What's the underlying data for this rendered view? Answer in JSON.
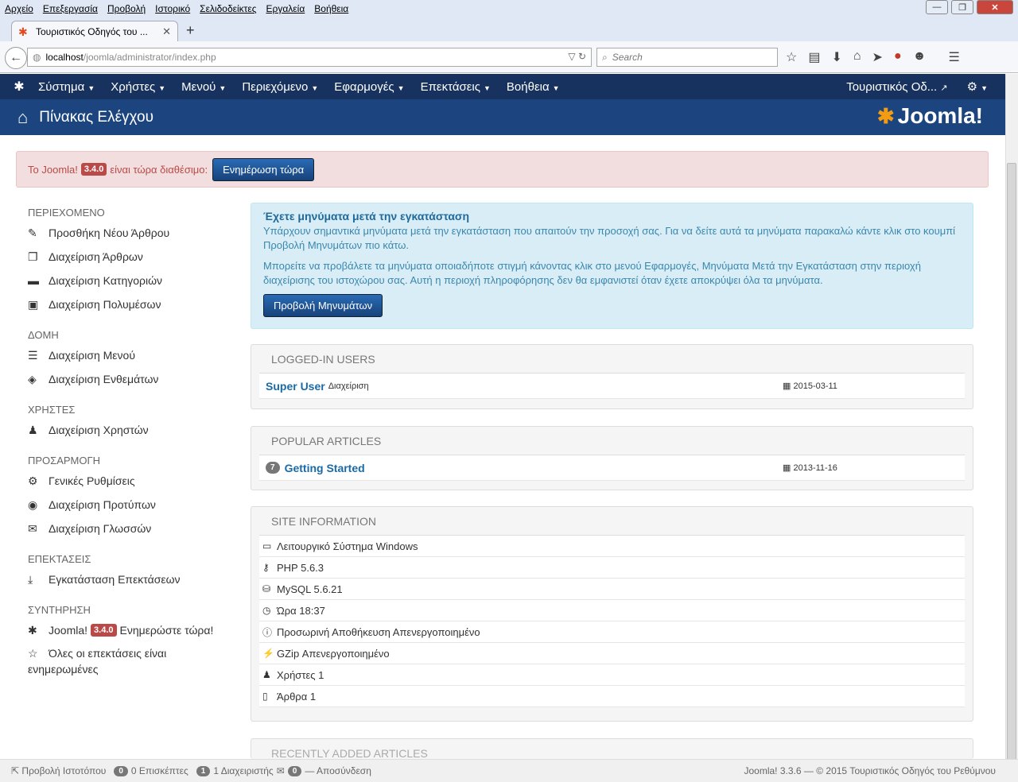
{
  "browser": {
    "menu": [
      "Αρχείο",
      "Επεξεργασία",
      "Προβολή",
      "Ιστορικό",
      "Σελιδοδείκτες",
      "Εργαλεία",
      "Βοήθεια"
    ],
    "window_controls": [
      "—",
      "❐",
      "✕"
    ],
    "tab_title": "Τουριστικός Οδηγός του ...",
    "url_host": "localhost",
    "url_path": "/joomla/administrator/index.php",
    "search_placeholder": "Search"
  },
  "joomla_nav": {
    "items": [
      "Σύστημα",
      "Χρήστες",
      "Μενού",
      "Περιεχόμενο",
      "Εφαρμογές",
      "Επεκτάσεις",
      "Βοήθεια"
    ],
    "site_link": "Τουριστικός Οδ...",
    "gear": "⚙"
  },
  "header": {
    "title": "Πίνακας Ελέγχου",
    "logo_text": "Joomla!"
  },
  "update_alert": {
    "prefix": "Το Joomla!",
    "version": "3.4.0",
    "suffix": "είναι τώρα διαθέσιμο:",
    "button": "Ενημέρωση τώρα"
  },
  "sidebar": {
    "groups": [
      {
        "title": "ΠΕΡΙΕΧΟΜΕΝΟ",
        "items": [
          {
            "icon": "✎",
            "label": "Προσθήκη Νέου Άρθρου"
          },
          {
            "icon": "❐",
            "label": "Διαχείριση Άρθρων"
          },
          {
            "icon": "▬",
            "label": "Διαχείριση Κατηγοριών"
          },
          {
            "icon": "▣",
            "label": "Διαχείριση Πολυμέσων"
          }
        ]
      },
      {
        "title": "ΔΟΜΗ",
        "items": [
          {
            "icon": "☰",
            "label": "Διαχείριση Μενού"
          },
          {
            "icon": "◈",
            "label": "Διαχείριση Ενθεμάτων"
          }
        ]
      },
      {
        "title": "ΧΡΗΣΤΕΣ",
        "items": [
          {
            "icon": "♟",
            "label": "Διαχείριση Χρηστών"
          }
        ]
      },
      {
        "title": "ΠΡΟΣΑΡΜΟΓΗ",
        "items": [
          {
            "icon": "⚙",
            "label": "Γενικές Ρυθμίσεις"
          },
          {
            "icon": "◉",
            "label": "Διαχείριση Προτύπων"
          },
          {
            "icon": "✉",
            "label": "Διαχείριση Γλωσσών"
          }
        ]
      },
      {
        "title": "ΕΠΕΚΤΑΣΕΙΣ",
        "items": [
          {
            "icon": "⤓",
            "label": "Εγκατάσταση Επεκτάσεων"
          }
        ]
      }
    ],
    "maintenance_title": "ΣΥΝΤΗΡΗΣΗ",
    "maintenance_joomla": "Joomla!",
    "maintenance_version": "3.4.0",
    "maintenance_update": "Ενημερώστε τώρα!",
    "maintenance_ext": "Όλες οι επεκτάσεις είναι ενημερωμένες"
  },
  "postinstall": {
    "title": "Έχετε μηνύματα μετά την εγκατάσταση",
    "p1": "Υπάρχουν σημαντικά μηνύματα μετά την εγκατάσταση που απαιτούν την προσοχή σας. Για να δείτε αυτά τα μηνύματα παρακαλώ κάντε κλικ στο κουμπί Προβολή Μηνυμάτων πιο κάτω.",
    "p2": "Μπορείτε να προβάλετε τα μηνύματα οποιαδήποτε στιγμή κάνοντας κλικ στο μενού Εφαρμογές, Μηνύματα Μετά την Εγκατάσταση στην περιοχή διαχείρισης του ιστοχώρου σας. Αυτή η περιοχή πληροφόρησης δεν θα εμφανιστεί όταν έχετε αποκρύψει όλα τα μηνύματα.",
    "button": "Προβολή Μηνυμάτων"
  },
  "logged_in": {
    "title": "LOGGED-IN USERS",
    "user": "Super User",
    "role": "Διαχείριση",
    "date": "2015-03-11"
  },
  "popular": {
    "title": "POPULAR ARTICLES",
    "hits": "7",
    "article": "Getting Started",
    "date": "2013-11-16"
  },
  "site_info": {
    "title": "SITE INFORMATION",
    "rows": [
      {
        "icon": "▭",
        "text": "Λειτουργικό Σύστημα Windows"
      },
      {
        "icon": "⚷",
        "text": "PHP 5.6.3"
      },
      {
        "icon": "⛁",
        "text": "MySQL 5.6.21"
      },
      {
        "icon": "◷",
        "text": "Ώρα 18:37"
      },
      {
        "icon": "ⓘ",
        "text": "Προσωρινή Αποθήκευση Απενεργοποιημένο"
      },
      {
        "icon": "⚡",
        "text": "GZip Απενεργοποιημένο"
      },
      {
        "icon": "♟",
        "text": "Χρήστες 1"
      },
      {
        "icon": "▯",
        "text": "Άρθρα 1"
      }
    ]
  },
  "recent": {
    "title": "RECENTLY ADDED ARTICLES"
  },
  "status": {
    "view_site": "Προβολή Ιστοτόπου",
    "visitors_count": "0",
    "visitors": "0 Επισκέπτες",
    "admins_count": "1",
    "admins": "1 Διαχειριστής",
    "messages_count": "0",
    "logout": "Αποσύνδεση",
    "version": "Joomla! 3.3.6",
    "copyright": "— © 2015 Τουριστικός Οδηγός του Ρεθύμνου"
  }
}
